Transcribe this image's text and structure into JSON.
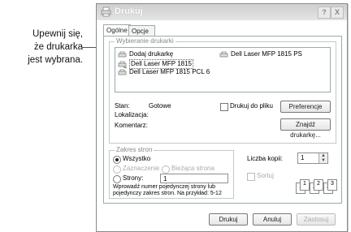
{
  "callout": {
    "line1": "Upewnij się,",
    "line2": "że drukarka",
    "line3": "jest wybrana."
  },
  "dialog": {
    "title": "Drukuj",
    "help_glyph": "?",
    "close_glyph": "X",
    "tabs": [
      "Ogólne",
      "Opcje"
    ],
    "printer_group_label": "Wybieranie drukarki",
    "printers": [
      {
        "label": "Dodaj drukarkę",
        "icon": "add-printer-icon"
      },
      {
        "label": "Dell Laser MFP 1815",
        "icon": "printer-icon",
        "selected": true
      },
      {
        "label": "Dell Laser MFP 1815 PCL 6",
        "icon": "printer-icon"
      },
      {
        "label": "Dell Laser MFP 1815 PS",
        "icon": "printer-icon"
      }
    ],
    "status_label": "Stan:",
    "status_value": "Gotowe",
    "location_label": "Lokalizacja:",
    "comment_label": "Komentarz:",
    "print_to_file_label": "Drukuj do pliku",
    "preferences_button": "Preferencje",
    "find_printer_button": "Znajdź drukarkę...",
    "range_group_label": "Zakres stron",
    "range_all": "Wszystko",
    "range_selection": "Zaznaczenie",
    "range_current": "Bieżąca strona",
    "range_pages": "Strony:",
    "range_pages_value": "1",
    "range_hint": "Wprowadź numer pojedynczej strony lub pojedynczy zakres stron. Na przykład: 5-12",
    "copies_label": "Liczba kopii:",
    "copies_value": "1",
    "collate_label": "Sortuj",
    "collate_pages": [
      "1",
      "1",
      "2",
      "2",
      "3",
      "3"
    ],
    "print_button": "Drukuj",
    "cancel_button": "Anuluj",
    "apply_button": "Zastosuj"
  }
}
